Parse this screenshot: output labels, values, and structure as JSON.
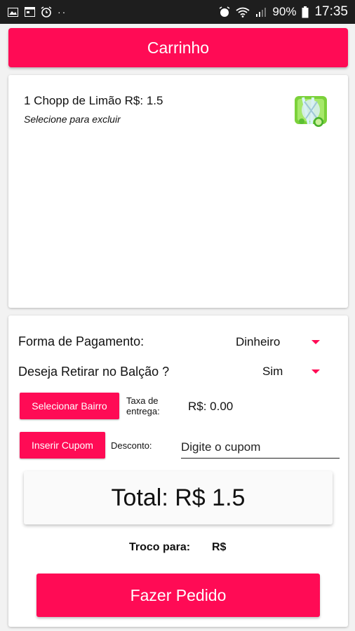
{
  "status_bar": {
    "battery": "90%",
    "time": "17:35",
    "icons_left": [
      "image-icon",
      "calendar-icon",
      "alarm-icon",
      "more-dots"
    ],
    "icons_right": [
      "alarm-icon",
      "wifi-icon",
      "signal-icon",
      "battery-icon"
    ]
  },
  "header": {
    "title": "Carrinho"
  },
  "cart": {
    "items": [
      {
        "title": "1 Chopp de Limão R$: 1.5",
        "hint": "Selecione para excluir",
        "thumbnail": "lime-drink-image"
      }
    ]
  },
  "options": {
    "payment_label": "Forma de Pagamento:",
    "payment_value": "Dinheiro",
    "pickup_label": "Deseja Retirar no Balção ?",
    "pickup_value": "Sim",
    "neighborhood_button": "Selecionar Bairro",
    "delivery_fee_label": "Taxa de entrega:",
    "delivery_fee_value": "R$: 0.00",
    "coupon_button": "Inserir Cupom",
    "discount_label": "Desconto:",
    "coupon_placeholder": "Digite o cupom",
    "total": "Total: R$ 1.5",
    "change_label": "Troco para:",
    "change_currency": "R$",
    "order_button": "Fazer Pedido"
  },
  "colors": {
    "accent": "#ff0b55",
    "statusbar": "#1e1e1e",
    "background": "#f2f2f2"
  }
}
